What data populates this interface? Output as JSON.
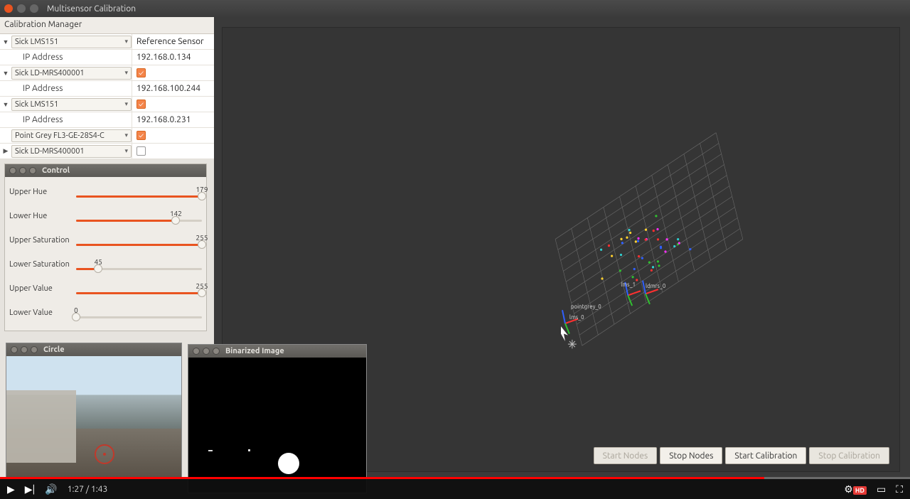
{
  "window": {
    "title": "Multisensor Calibration"
  },
  "manager": {
    "header": "Calibration Manager",
    "reference_label": "Reference Sensor",
    "ip_label": "IP Address",
    "sensors": [
      {
        "name": "Sick LMS151",
        "ip": "192.168.0.134",
        "checked": null,
        "is_reference": true,
        "expanded": true
      },
      {
        "name": "Sick LD-MRS400001",
        "ip": "192.168.100.244",
        "checked": true,
        "expanded": true
      },
      {
        "name": "Sick LMS151",
        "ip": "192.168.0.231",
        "checked": true,
        "expanded": true
      },
      {
        "name": "Point Grey FL3-GE-28S4-C",
        "ip": null,
        "checked": true,
        "expanded": false,
        "leaf": true
      },
      {
        "name": "Sick LD-MRS400001",
        "ip": null,
        "checked": false,
        "expanded": false
      }
    ]
  },
  "control": {
    "title": "Control",
    "sliders": [
      {
        "label": "Upper Hue",
        "value": 179,
        "max": 179
      },
      {
        "label": "Lower Hue",
        "value": 142,
        "max": 179
      },
      {
        "label": "Upper Saturation",
        "value": 255,
        "max": 255
      },
      {
        "label": "Lower Saturation",
        "value": 45,
        "max": 255
      },
      {
        "label": "Upper Value",
        "value": 255,
        "max": 255
      },
      {
        "label": "Lower Value",
        "value": 0,
        "max": 255
      }
    ]
  },
  "previews": {
    "circle_title": "Circle",
    "binarized_title": "Binarized Image"
  },
  "actions": {
    "start_nodes": "Start Nodes",
    "stop_nodes": "Stop Nodes",
    "start_cal": "Start Calibration",
    "stop_cal": "Stop Calibration"
  },
  "video": {
    "current": "1:27",
    "total": "1:43",
    "played_pct": 84,
    "hd_label": "HD"
  },
  "viewport": {
    "labels": [
      "lms_0",
      "lms_1",
      "ldmrs_0",
      "pointgrey_0"
    ]
  }
}
